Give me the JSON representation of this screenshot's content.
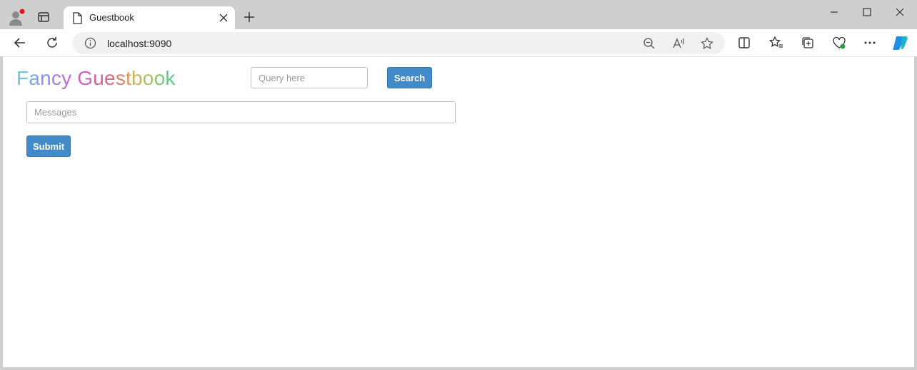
{
  "browser": {
    "tab_title": "Guestbook",
    "address": "localhost:9090"
  },
  "page": {
    "brand_letters": [
      {
        "ch": "F",
        "color": "#6fc3e0"
      },
      {
        "ch": "a",
        "color": "#7aa9e6"
      },
      {
        "ch": "n",
        "color": "#8c8fe6"
      },
      {
        "ch": "c",
        "color": "#a77fe0"
      },
      {
        "ch": "y",
        "color": "#b974d4"
      },
      {
        "ch": " ",
        "color": "#ffffff"
      },
      {
        "ch": "G",
        "color": "#cc63b8"
      },
      {
        "ch": "u",
        "color": "#d4609e"
      },
      {
        "ch": "e",
        "color": "#dc6a84"
      },
      {
        "ch": "s",
        "color": "#e07f6d"
      },
      {
        "ch": "t",
        "color": "#dc9a5d"
      },
      {
        "ch": "b",
        "color": "#c8b45a"
      },
      {
        "ch": "o",
        "color": "#a3c35c"
      },
      {
        "ch": "o",
        "color": "#7ccb6c"
      },
      {
        "ch": "k",
        "color": "#5fcc88"
      }
    ],
    "search_placeholder": "Query here",
    "search_button": "Search",
    "messages_placeholder": "Messages",
    "submit_button": "Submit"
  },
  "colors": {
    "button": "#428bca"
  }
}
